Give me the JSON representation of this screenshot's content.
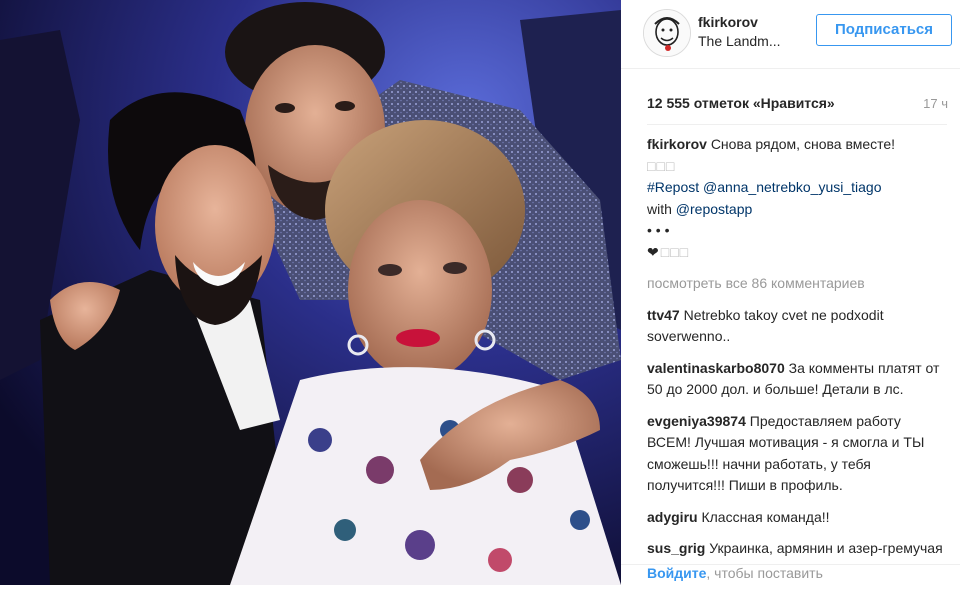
{
  "post": {
    "username": "fkirkorov",
    "location": "The Landm...",
    "follow_label": "Подписаться",
    "likes": "12 555 отметок «Нравится»",
    "time_ago": "17 ч"
  },
  "caption": {
    "user": "fkirkorov",
    "text": "Снова рядом, снова вместе!",
    "glyphs_line": "□□□",
    "hashtag": "#Repost",
    "mention1": "@anna_netrebko_yusi_tiago",
    "with_word": "with",
    "mention2": "@repostapp",
    "dots": "• • •",
    "heart": "❤",
    "heart_glyphs": "□□□"
  },
  "view_all": "посмотреть все 86 комментариев",
  "comments": [
    {
      "user": "ttv47",
      "text": "Netrebko takoy cvet ne podxodit soverwenno.."
    },
    {
      "user": "valentinaskarbo8070",
      "text": "За комменты платят от 50 до 2000 дол. и больше! Детали в лс."
    },
    {
      "user": "evgeniya39874",
      "text": "Предоставляем работу ВСЕМ! Лучшая мотивация - я смогла и ТЫ сможешь!!! начни работать, у тебя получится!!! Пиши в профиль."
    },
    {
      "user": "adygiru",
      "text": "Классная команда!!"
    },
    {
      "user": "sus_grig",
      "text": "Украинка, армянин и азер-гремучая смесь))))"
    }
  ],
  "footer": {
    "login": "Войдите",
    "rest": ", чтобы поставить"
  },
  "colors": {
    "accent": "#3897f0",
    "link": "#003569",
    "muted": "#999999"
  },
  "icons": [
    "avatar-portrait"
  ]
}
